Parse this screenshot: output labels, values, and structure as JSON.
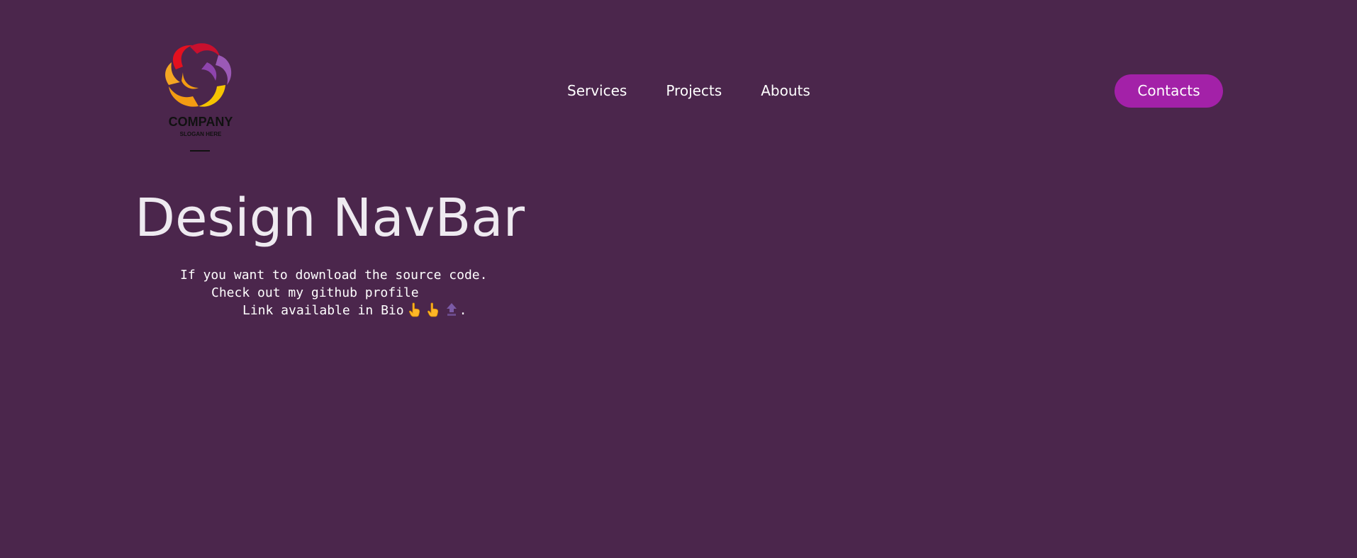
{
  "logo": {
    "company": "COMPANY",
    "slogan": "SLOGAN HERE"
  },
  "nav": {
    "items": [
      {
        "label": "Services"
      },
      {
        "label": "Projects"
      },
      {
        "label": "Abouts"
      }
    ],
    "contacts_label": "Contacts"
  },
  "hero": {
    "title": "Design NavBar",
    "line1": "If you want to download the source code.",
    "line2": "Check out my github profile",
    "line3": "Link available in Bio",
    "line3_end": "."
  },
  "icons": [
    "pointing-up-hand-icon",
    "pointing-up-hand-icon",
    "top-arrow-icon"
  ],
  "colors": {
    "background": "#4b264c",
    "accent": "#a321a8",
    "title": "#eeeaf0"
  }
}
